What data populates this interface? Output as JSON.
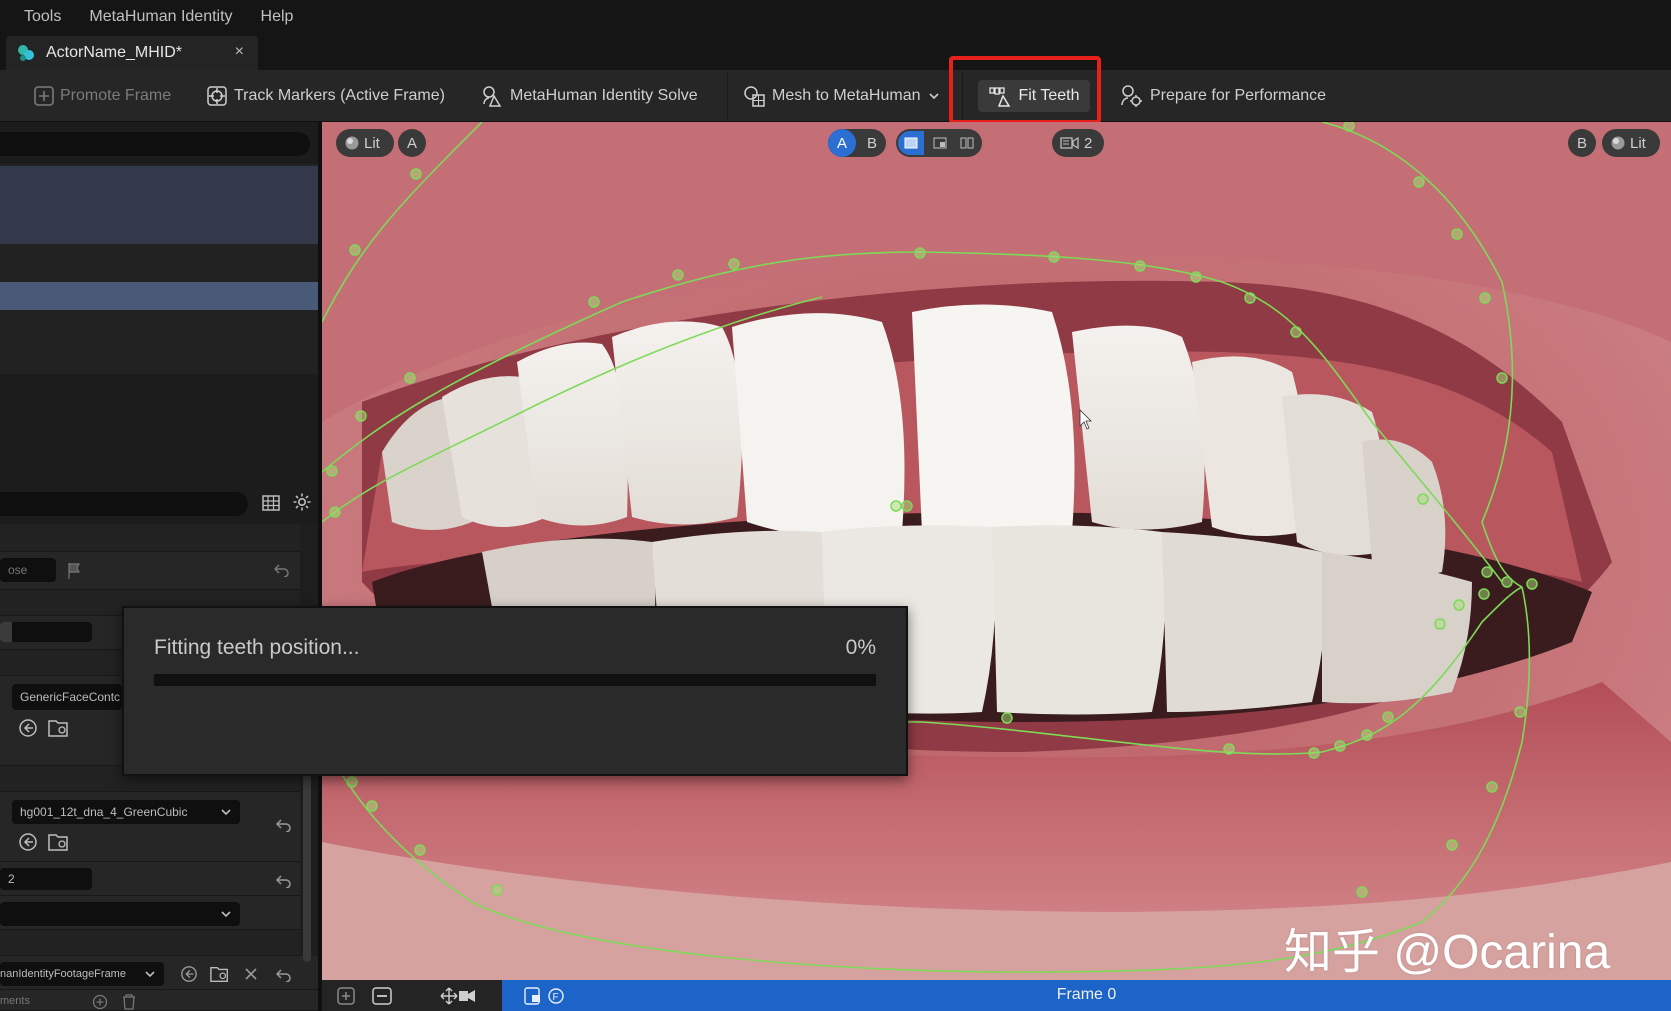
{
  "menu": {
    "items": [
      "Tools",
      "MetaHuman Identity",
      "Help"
    ]
  },
  "tab": {
    "label": "ActorName_MHID*",
    "close": "×"
  },
  "toolbar": {
    "promote_frame": "Promote Frame",
    "track_markers": "Track Markers (Active Frame)",
    "identity_solve": "MetaHuman Identity Solve",
    "mesh_to_metahuman": "Mesh to MetaHuman",
    "fit_teeth": "Fit Teeth",
    "prepare_performance": "Prepare for Performance",
    "highlight_color": "#e8201a"
  },
  "left_panel": {
    "partial_label_1": "ose",
    "face_contour_combo": "GenericFaceContc",
    "dna_combo": "hg001_12t_dna_4_GreenCubic",
    "partial_field": "2",
    "footage_combo": "nanIdentityFootageFrame",
    "bottom_partial": "ments"
  },
  "viewport": {
    "left_lit": "Lit",
    "left_a": "A",
    "ab_a": "A",
    "ab_b": "B",
    "camera_count": "2",
    "right_b": "B",
    "right_lit": "Lit",
    "overlay_color": "#7ed957",
    "watermark": "知乎 @Ocarina"
  },
  "progress": {
    "text": "Fitting teeth position...",
    "percent_label": "0%",
    "value": 0
  },
  "timeline": {
    "frame_label": "Frame 0",
    "accent": "#1c64c8"
  }
}
